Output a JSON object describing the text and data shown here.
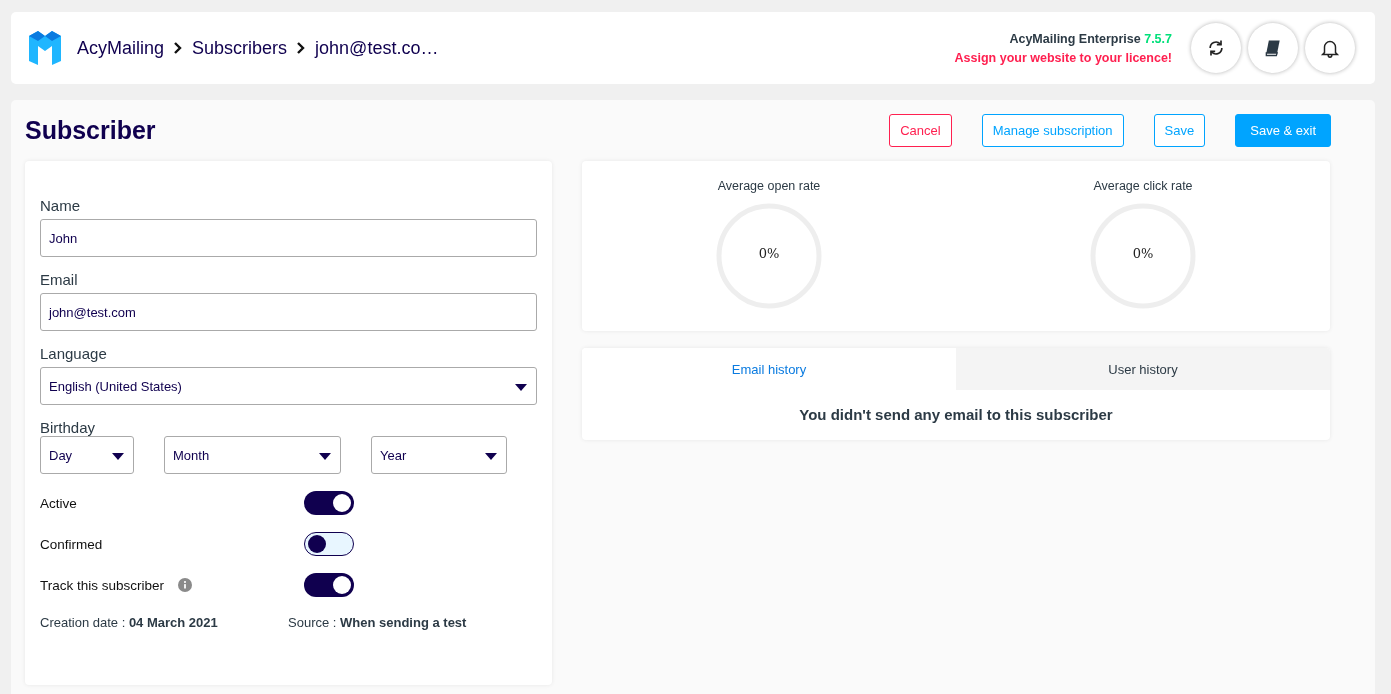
{
  "breadcrumb": [
    "AcyMailing",
    "Subscribers",
    "john@test.co…"
  ],
  "licence": {
    "product": "AcyMailing Enterprise",
    "version": "7.5.7",
    "warning": "Assign your website to your licence!"
  },
  "title": "Subscriber",
  "actions": [
    {
      "label": "Cancel",
      "kind": "danger"
    },
    {
      "label": "Manage subscription",
      "kind": "outline"
    },
    {
      "label": "Save",
      "kind": "outline"
    },
    {
      "label": "Save & exit",
      "kind": "primary"
    }
  ],
  "fields": [
    {
      "label": "Name",
      "value": "John",
      "kind": "text"
    },
    {
      "label": "Email",
      "value": "john@test.com",
      "kind": "text"
    },
    {
      "label": "Language",
      "value": "English (United States)",
      "kind": "select"
    }
  ],
  "birthday": {
    "label": "Birthday",
    "selects": [
      "Day",
      "Month",
      "Year"
    ]
  },
  "toggles": [
    {
      "label": "Active",
      "on": true,
      "info": false
    },
    {
      "label": "Confirmed",
      "on": false,
      "info": false
    },
    {
      "label": "Track this subscriber",
      "on": true,
      "info": true
    }
  ],
  "meta": [
    {
      "label": "Creation date :",
      "value": "04 March 2021"
    },
    {
      "label": "Source :",
      "value": "When sending a test"
    }
  ],
  "stats": [
    {
      "label": "Average open rate",
      "reading": "0%"
    },
    {
      "label": "Average click rate",
      "reading": "0%"
    }
  ],
  "history_tabs": [
    {
      "label": "Email history",
      "selected": true
    },
    {
      "label": "User history",
      "selected": false
    }
  ],
  "empty_message": "You didn't send any email to this subscriber"
}
